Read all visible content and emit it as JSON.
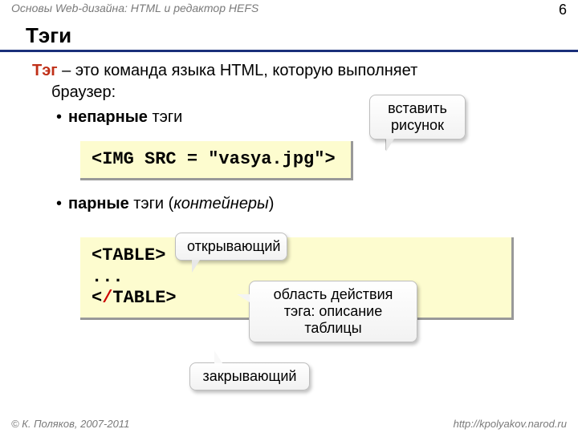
{
  "header": {
    "course": "Основы Web-дизайна: HTML и редактор HEFS",
    "page": "6"
  },
  "title": "Тэги",
  "intro": {
    "term": "Тэг",
    "rest": " – это команда языка HTML, которую выполняет",
    "rest2": "браузер:"
  },
  "bullets": {
    "b1_bold": "непарные",
    "b1_rest": " тэги",
    "b2_bold": "парные",
    "b2_rest": " тэги (",
    "b2_ital": "контейнеры",
    "b2_close": ")"
  },
  "code1": "<IMG SRC = \"vasya.jpg\">",
  "code2": {
    "open_l": "<",
    "open_name": "TABLE",
    "open_r": ">",
    "mid": "...",
    "close_l": "<",
    "close_slash": "/",
    "close_name": "TABLE",
    "close_r": ">"
  },
  "callouts": {
    "c1a": "вставить",
    "c1b": "рисунок",
    "c2": "открывающий",
    "c3a": "область действия",
    "c3b": "тэга: описание",
    "c3c": "таблицы",
    "c4": "закрывающий"
  },
  "footer": {
    "left": "© К. Поляков, 2007-2011",
    "right": "http://kpolyakov.narod.ru"
  }
}
